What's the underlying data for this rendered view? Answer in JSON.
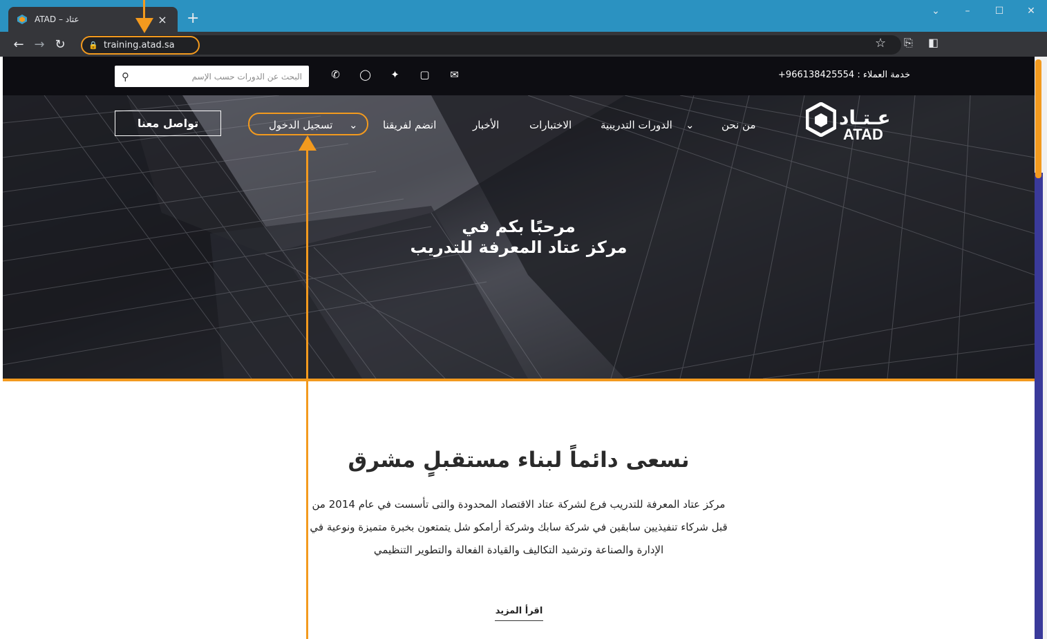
{
  "browser": {
    "tab_title": "ATAD – عتاد",
    "new_tab": "+",
    "close": "×",
    "url": "training.atad.sa",
    "win_controls": [
      "⌄",
      "–",
      "☐",
      "✕"
    ]
  },
  "topbar": {
    "search_placeholder": "البحث عن الدورات حسب الإسم",
    "hotline": "خدمة العملاء : 966138425554+",
    "social": [
      "phone-icon",
      "whatsapp-icon",
      "twitter-icon",
      "instagram-icon",
      "mail-icon"
    ]
  },
  "nav": {
    "logo_ar": "عـتـاد",
    "logo_en": "ATAD",
    "about": "من نحن",
    "courses": "الدورات التدريبية",
    "exams": "الاختبارات",
    "news": "الأخبار",
    "join": "انضم لفريقنا",
    "login": "تسجيل الدخول",
    "contact": "تواصل معنا"
  },
  "hero": {
    "line1": "مرحبًا بكم في",
    "line2": "مركز عتاد المعرفة للتدريب"
  },
  "content": {
    "title": "نسعى دائماً لبناء مستقبلٍ مشرق",
    "line1": "مركز عتاد المعرفة للتدريب فرع لشركة عتاد الاقتصاد المحدودة والتى تأسست في عام 2014 من",
    "line2": "قبل شركاء تنفيذيين سابقين في شركة سابك وشركة أرامكو شل يتمتعون بخبرة متميزة ونوعية في",
    "line3": "الإدارة والصناعة وترشيد التكاليف والقيادة الفعالة والتطوير التنظيمي",
    "read_more": "اقرأ المزيد"
  },
  "colors": {
    "accent": "#f39a1e",
    "tabbar": "#2b92c1",
    "topbar": "#0d0d12"
  }
}
